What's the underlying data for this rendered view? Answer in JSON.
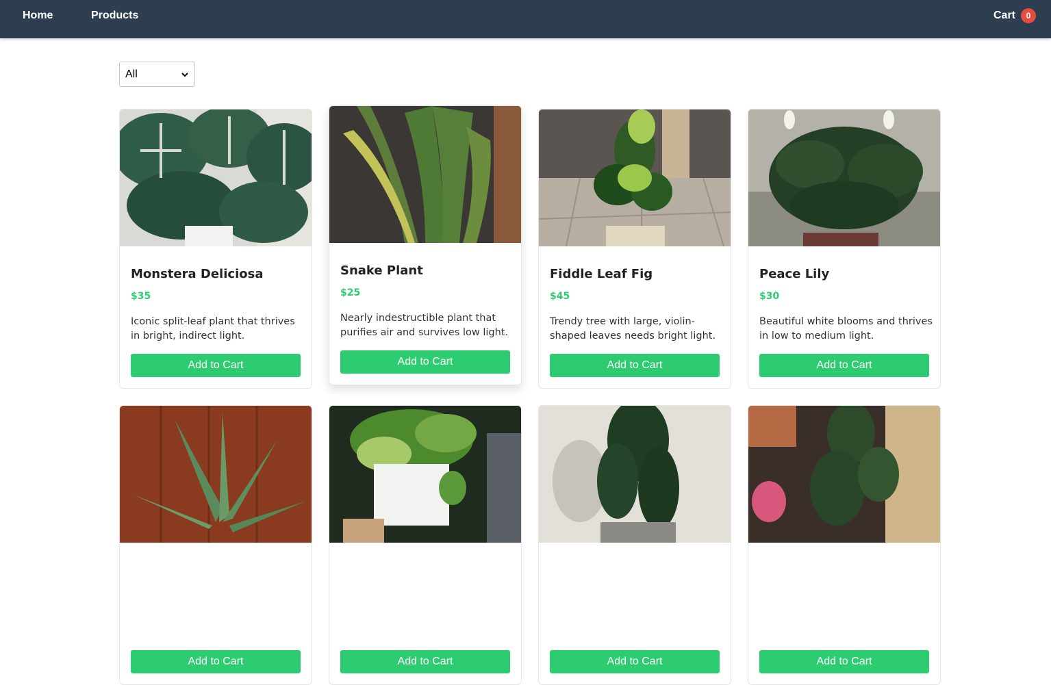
{
  "nav": {
    "home_label": "Home",
    "products_label": "Products",
    "cart_label": "Cart",
    "cart_count": "0"
  },
  "filter": {
    "selected": "All"
  },
  "button_label": "Add to Cart",
  "colors": {
    "navbar": "#2c3e50",
    "accent": "#2ecc71",
    "badge": "#e74c3c"
  },
  "products": [
    {
      "name": "Monstera Deliciosa",
      "price": "$35",
      "description": "Iconic split-leaf plant that thrives in bright, indirect light."
    },
    {
      "name": "Snake Plant",
      "price": "$25",
      "description": "Nearly indestructible plant that purifies air and survives low light."
    },
    {
      "name": "Fiddle Leaf Fig",
      "price": "$45",
      "description": "Trendy tree with large, violin-shaped leaves needs bright light."
    },
    {
      "name": "Peace Lily",
      "price": "$30",
      "description": "Beautiful white blooms and thrives in low to medium light."
    },
    {
      "name": "",
      "price": "",
      "description": ""
    },
    {
      "name": "",
      "price": "",
      "description": ""
    },
    {
      "name": "",
      "price": "",
      "description": ""
    },
    {
      "name": "",
      "price": "",
      "description": ""
    }
  ]
}
